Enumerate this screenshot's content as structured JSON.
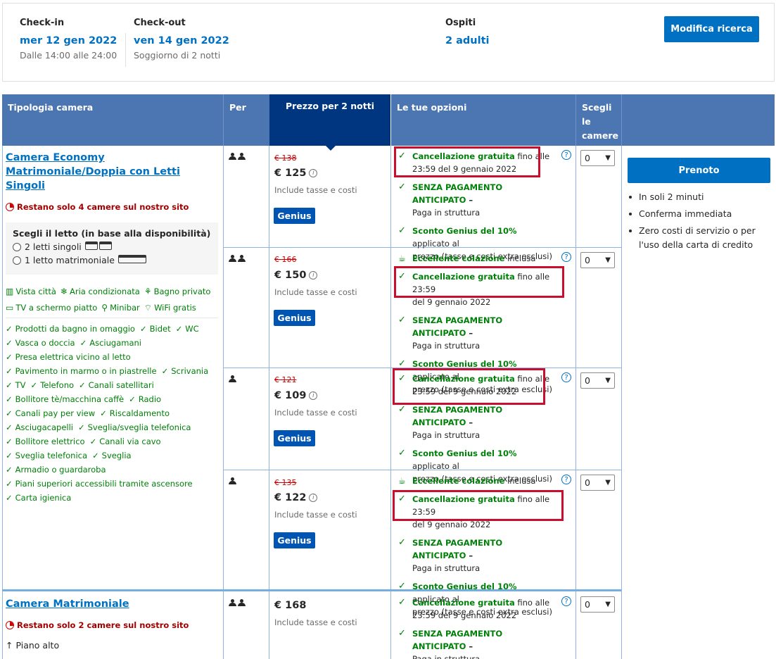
{
  "search": {
    "checkin_label": "Check-in",
    "checkin_date": "mer 12 gen 2022",
    "checkin_time": "Dalle 14:00 alle 24:00",
    "checkout_label": "Check-out",
    "checkout_date": "ven 14 gen 2022",
    "stay": "Soggiorno di 2 notti",
    "guests_label": "Ospiti",
    "guests_value": "2 adulti",
    "modify_button": "Modifica ricerca"
  },
  "table_header": {
    "room_type": "Tipologia camera",
    "per": "Per",
    "price": "Prezzo per 2 notti",
    "options": "Le tue opzioni",
    "select": [
      "Scegli",
      "le",
      "camere"
    ]
  },
  "room1": {
    "name_lines": [
      "Camera Economy",
      "Matrimoniale/Doppia con Letti",
      "Singoli"
    ],
    "urgency": "Restano solo 4 camere sul nostro sito",
    "bed_title": "Scegli il letto (in base alla disponibilità)",
    "bed_option_1": "2 letti singoli",
    "bed_option_2": "1 letto matrimoniale",
    "facilities_line1": [
      "Vista città",
      "Aria condizionata",
      "Bagno privato"
    ],
    "facilities_line2": [
      "TV a schermo piatto",
      "Minibar",
      "WiFi gratis"
    ],
    "amenities": [
      [
        "Prodotti da bagno in omaggio",
        "Bidet",
        "WC"
      ],
      [
        "Vasca o doccia",
        "Asciugamani"
      ],
      [
        "Presa elettrica vicino al letto"
      ],
      [
        "Pavimento in marmo o in piastrelle",
        "Scrivania"
      ],
      [
        "TV",
        "Telefono",
        "Canali satellitari"
      ],
      [
        "Bollitore tè/macchina caffè",
        "Radio"
      ],
      [
        "Canali pay per view",
        "Riscaldamento"
      ],
      [
        "Asciugacapelli",
        "Sveglia/sveglia telefonica"
      ],
      [
        "Bollitore elettrico",
        "Canali via cavo"
      ],
      [
        "Sveglia telefonica",
        "Sveglia"
      ],
      [
        "Armadio o guardaroba"
      ],
      [
        "Piani superiori accessibili tramite ascensore"
      ],
      [
        "Carta igienica"
      ]
    ]
  },
  "room2": {
    "name": "Camera Matrimoniale",
    "urgency": "Restano solo 2 camere sul nostro sito",
    "feature": "Piano alto"
  },
  "rates": [
    {
      "old": "€ 138",
      "price": "€ 125",
      "taxes": "Include tasse e costi",
      "genius": "Genius",
      "select": "0"
    },
    {
      "old": "€ 166",
      "price": "€ 150",
      "taxes": "Include tasse e costi",
      "genius": "Genius",
      "select": "0"
    },
    {
      "old": "€ 121",
      "price": "€ 109",
      "taxes": "Include tasse e costi",
      "genius": "Genius",
      "select": "0"
    },
    {
      "old": "€ 135",
      "price": "€ 122",
      "taxes": "Include tasse e costi",
      "genius": "Genius",
      "select": "0"
    },
    {
      "price": "€ 168",
      "taxes": "Include tasse e costi",
      "select": "0"
    }
  ],
  "options": {
    "breakfast_bold": "Eccellente colazione",
    "breakfast_rest": "inclusa",
    "cancel_bold": "Cancellazione gratuita",
    "cancel_rest_a": "fino alle",
    "cancel_rest_a2": "23:59 del 9 gennaio 2022",
    "cancel_rest_b": "fino alle 23:59",
    "cancel_rest_b2": "del 9 gennaio 2022",
    "nopay_bold": "SENZA PAGAMENTO ANTICIPATO",
    "nopay_dash": " –",
    "nopay_rest": "Paga in struttura",
    "genius_bold": "Sconto Genius del 10%",
    "genius_rest": "applicato al",
    "genius_rest2": "prezzo (tasse e costi extra esclusi)"
  },
  "reserve": {
    "button": "Prenoto",
    "benefits": [
      "In soli 2 minuti",
      "Conferma immediata",
      "Zero costi di servizio o per l'uso della carta di credito"
    ]
  },
  "colors": {
    "brand_blue": "#0071c2",
    "header_blue": "#4c76b2",
    "dark_blue": "#003580",
    "green": "#008009",
    "red_highlight": "#c8102e"
  }
}
